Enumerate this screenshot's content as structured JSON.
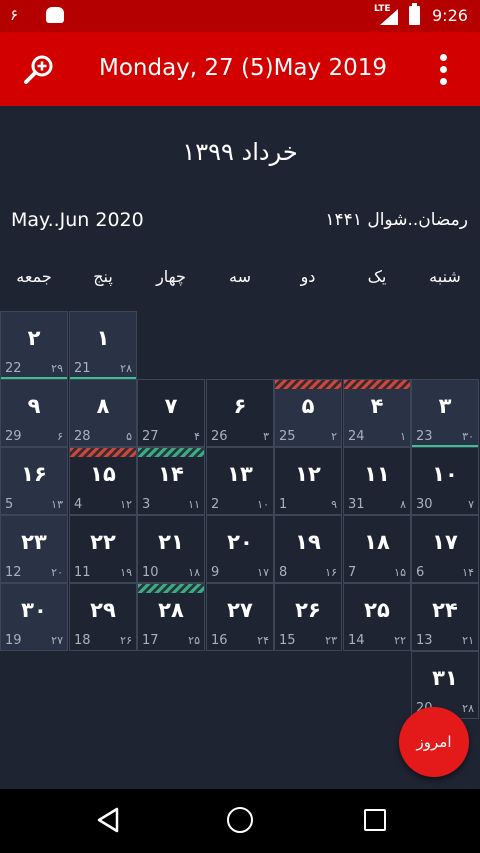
{
  "status_bar": {
    "left_text": "۶",
    "network_label": "LTE",
    "time": "9:26",
    "icons": [
      "android-icon",
      "signal-icon",
      "battery-charging-icon"
    ]
  },
  "app_bar": {
    "title": "Monday, 27 (5)May 2019",
    "icons": [
      "search-zoom-icon",
      "overflow-menu-icon"
    ],
    "color": "#d30000"
  },
  "calendar": {
    "month_title": "خرداد ۱۳۹۹",
    "gregorian_range": "May..Jun 2020",
    "hijri_range": "رمضان..شوال ۱۴۴۱",
    "weekdays": [
      "شنبه",
      "یک",
      "دو",
      "سه",
      "چهار",
      "پنج",
      "جمعه"
    ],
    "weeks": [
      [
        null,
        null,
        null,
        null,
        null,
        {
          "day": "۱",
          "greg": "21",
          "hijri": "۲۸",
          "shade": true,
          "underline": true
        },
        {
          "day": "۲",
          "greg": "22",
          "hijri": "۲۹",
          "shade": true,
          "underline": true
        }
      ],
      [
        {
          "day": "۳",
          "greg": "23",
          "hijri": "۳۰",
          "shade": true,
          "underline": true
        },
        {
          "day": "۴",
          "greg": "24",
          "hijri": "۱",
          "shade": true,
          "hatch": "red"
        },
        {
          "day": "۵",
          "greg": "25",
          "hijri": "۲",
          "shade": true,
          "hatch": "red"
        },
        {
          "day": "۶",
          "greg": "26",
          "hijri": "۳",
          "shade": false
        },
        {
          "day": "۷",
          "greg": "27",
          "hijri": "۴",
          "shade": false
        },
        {
          "day": "۸",
          "greg": "28",
          "hijri": "۵",
          "shade": true
        },
        {
          "day": "۹",
          "greg": "29",
          "hijri": "۶",
          "shade": true
        }
      ],
      [
        {
          "day": "۱۰",
          "greg": "30",
          "hijri": "۷",
          "shade": false
        },
        {
          "day": "۱۱",
          "greg": "31",
          "hijri": "۸",
          "shade": false
        },
        {
          "day": "۱۲",
          "greg": "1",
          "hijri": "۹",
          "shade": false
        },
        {
          "day": "۱۳",
          "greg": "2",
          "hijri": "۱۰",
          "shade": false
        },
        {
          "day": "۱۴",
          "greg": "3",
          "hijri": "۱۱",
          "shade": false,
          "hatch": "green"
        },
        {
          "day": "۱۵",
          "greg": "4",
          "hijri": "۱۲",
          "shade": false,
          "hatch": "red"
        },
        {
          "day": "۱۶",
          "greg": "5",
          "hijri": "۱۳",
          "shade": true
        }
      ],
      [
        {
          "day": "۱۷",
          "greg": "6",
          "hijri": "۱۴",
          "shade": false
        },
        {
          "day": "۱۸",
          "greg": "7",
          "hijri": "۱۵",
          "shade": false
        },
        {
          "day": "۱۹",
          "greg": "8",
          "hijri": "۱۶",
          "shade": false
        },
        {
          "day": "۲۰",
          "greg": "9",
          "hijri": "۱۷",
          "shade": false
        },
        {
          "day": "۲۱",
          "greg": "10",
          "hijri": "۱۸",
          "shade": false
        },
        {
          "day": "۲۲",
          "greg": "11",
          "hijri": "۱۹",
          "shade": false
        },
        {
          "day": "۲۳",
          "greg": "12",
          "hijri": "۲۰",
          "shade": true
        }
      ],
      [
        {
          "day": "۲۴",
          "greg": "13",
          "hijri": "۲۱",
          "shade": false
        },
        {
          "day": "۲۵",
          "greg": "14",
          "hijri": "۲۲",
          "shade": false
        },
        {
          "day": "۲۶",
          "greg": "15",
          "hijri": "۲۳",
          "shade": false
        },
        {
          "day": "۲۷",
          "greg": "16",
          "hijri": "۲۴",
          "shade": false
        },
        {
          "day": "۲۸",
          "greg": "17",
          "hijri": "۲۵",
          "shade": false,
          "hatch": "green"
        },
        {
          "day": "۲۹",
          "greg": "18",
          "hijri": "۲۶",
          "shade": false
        },
        {
          "day": "۳۰",
          "greg": "19",
          "hijri": "۲۷",
          "shade": true
        }
      ],
      [
        {
          "day": "۳۱",
          "greg": "20",
          "hijri": "۲۸",
          "shade": false
        },
        null,
        null,
        null,
        null,
        null,
        null
      ]
    ]
  },
  "fab": {
    "label": "امروز"
  },
  "nav_bar": {
    "icons": [
      "back-icon",
      "home-icon",
      "recent-apps-icon"
    ]
  }
}
